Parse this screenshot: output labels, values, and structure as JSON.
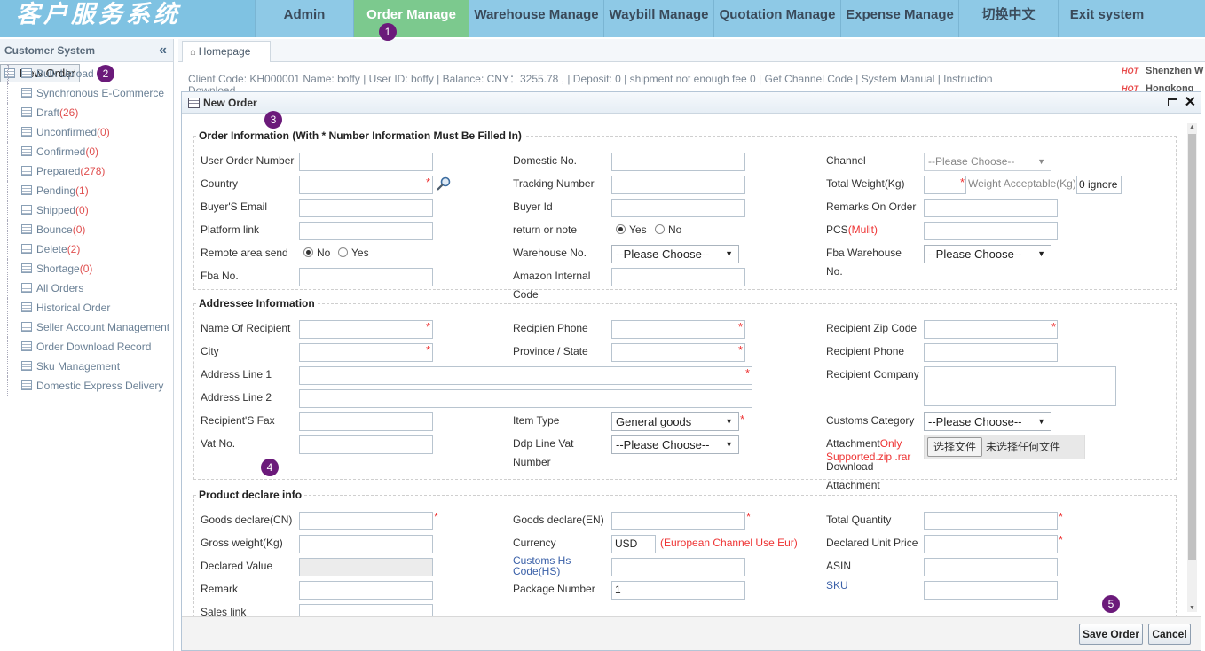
{
  "header": {
    "logo": "客户服务系统",
    "nav": [
      "Admin",
      "Order Manage",
      "Warehouse Manage",
      "Waybill Manage",
      "Quotation Manage",
      "Expense Manage",
      "切换中文",
      "Exit system"
    ],
    "active_nav": "Order Manage"
  },
  "badges": [
    "1",
    "2",
    "3",
    "4",
    "5"
  ],
  "sidebar": {
    "title": "Customer System",
    "collapse_icon": "«",
    "items": [
      {
        "label": "New Order",
        "count": ""
      },
      {
        "label": "Bulk Upload",
        "count": ""
      },
      {
        "label": "Synchronous E-Commerce",
        "count": ""
      },
      {
        "label": "Draft",
        "count": "(26)"
      },
      {
        "label": "Unconfirmed",
        "count": "(0)"
      },
      {
        "label": "Confirmed",
        "count": "(0)"
      },
      {
        "label": "Prepared",
        "count": "(278)"
      },
      {
        "label": "Pending",
        "count": "(1)"
      },
      {
        "label": "Shipped",
        "count": "(0)"
      },
      {
        "label": "Bounce",
        "count": "(0)"
      },
      {
        "label": "Delete",
        "count": "(2)"
      },
      {
        "label": "Shortage",
        "count": "(0)"
      },
      {
        "label": "All Orders",
        "count": ""
      },
      {
        "label": "Historical Order",
        "count": ""
      },
      {
        "label": "Seller Account Management",
        "count": ""
      },
      {
        "label": "Order Download Record",
        "count": ""
      },
      {
        "label": "Sku Management",
        "count": ""
      },
      {
        "label": "Domestic Express Delivery",
        "count": ""
      }
    ]
  },
  "tabs": {
    "home": "Homepage"
  },
  "info_bar": {
    "text": "Client Code: KH000001   Name: boffy   |   User ID: boffy   |  Balance: CNY：3255.78 ,   |  Deposit: 0   |   shipment not enough fee 0   |  Get Channel Code   |  System Manual   |  Instruction",
    "overflow": "Download"
  },
  "hot_list": {
    "hot": "HOT",
    "items": [
      "Shenzhen W",
      "Hongkong"
    ]
  },
  "dialog": {
    "title": "New Order",
    "sections": {
      "order": "Order Information (With * Number Information Must Be Filled In)",
      "addressee": "Addressee Information",
      "product": "Product declare info"
    },
    "order": {
      "user_order_number": "User Order Number",
      "domestic_no": "Domestic No.",
      "channel": "Channel",
      "channel_value": "--Please Choose--",
      "country": "Country",
      "tracking_number": "Tracking Number",
      "total_weight": "Total Weight(Kg)",
      "weight_acceptable": "Weight Acceptable(Kg)",
      "weight_acceptable_value": "0 ignore",
      "buyer_email": "Buyer'S Email",
      "buyer_id": "Buyer Id",
      "remarks_on_order": "Remarks On Order",
      "platform_link": "Platform link",
      "return_or_note": "return or note",
      "yes": "Yes",
      "no": "No",
      "pcs": "PCS",
      "pcs_mulit": "(Mulit)",
      "remote_area": "Remote area send",
      "warehouse_no": "Warehouse No.",
      "please_choose": "--Please Choose--",
      "fba_warehouse_1": "Fba Warehouse",
      "fba_warehouse_2": "No.",
      "fba_no": "Fba No.",
      "amazon_code_1": "Amazon Internal",
      "amazon_code_2": "Code"
    },
    "addressee": {
      "name_of_recipient": "Name Of Recipient",
      "recipien_phone": "Recipien Phone",
      "zip_code": "Recipient Zip Code",
      "city": "City",
      "province": "Province / State",
      "recipient_phone": "Recipient Phone",
      "address1": "Address Line 1",
      "recipient_company": "Recipient Company",
      "address2": "Address Line 2",
      "fax": "Recipient'S Fax",
      "item_type": "Item Type",
      "item_type_value": "General goods",
      "customs_category": "Customs Category",
      "vat_no": "Vat No.",
      "ddp_1": "Ddp Line Vat",
      "ddp_2": "Number",
      "attachment": "Attachment",
      "only": "Only",
      "supported": "Supported.zip .rar",
      "download": "Download",
      "attachment2": "Attachment",
      "choose_file": "选择文件",
      "no_file": "未选择任何文件"
    },
    "product": {
      "goods_cn": "Goods declare(CN)",
      "goods_en": "Goods declare(EN)",
      "total_quantity": "Total Quantity",
      "gross_weight": "Gross weight(Kg)",
      "currency": "Currency",
      "currency_value": "USD",
      "currency_note": "(European Channel Use Eur)",
      "declared_unit_price": "Declared Unit Price",
      "declared_value": "Declared Value",
      "customs_hs_1": "Customs Hs",
      "customs_hs_2": "Code(HS)",
      "asin": "ASIN",
      "remark": "Remark",
      "package_number": "Package Number",
      "package_number_value": "1",
      "sku": "SKU",
      "sales_link": "Sales link"
    },
    "buttons": {
      "save": "Save Order",
      "cancel": "Cancel"
    }
  }
}
